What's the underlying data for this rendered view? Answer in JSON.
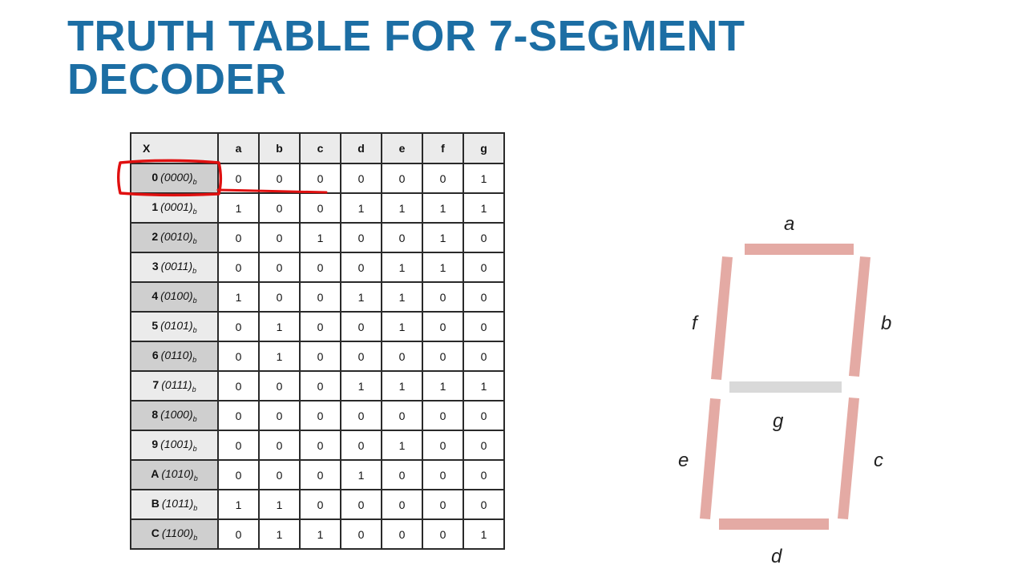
{
  "title_line1": "TRUTH TABLE FOR 7-SEGMENT",
  "title_line2": "DECODER",
  "table": {
    "headers": [
      "X",
      "a",
      "b",
      "c",
      "d",
      "e",
      "f",
      "g"
    ],
    "rows": [
      {
        "digit": "0",
        "binary": "(0000)",
        "base": "b",
        "segments": [
          "0",
          "0",
          "0",
          "0",
          "0",
          "0",
          "1"
        ]
      },
      {
        "digit": "1",
        "binary": "(0001)",
        "base": "b",
        "segments": [
          "1",
          "0",
          "0",
          "1",
          "1",
          "1",
          "1"
        ]
      },
      {
        "digit": "2",
        "binary": "(0010)",
        "base": "b",
        "segments": [
          "0",
          "0",
          "1",
          "0",
          "0",
          "1",
          "0"
        ]
      },
      {
        "digit": "3",
        "binary": "(0011)",
        "base": "b",
        "segments": [
          "0",
          "0",
          "0",
          "0",
          "1",
          "1",
          "0"
        ]
      },
      {
        "digit": "4",
        "binary": "(0100)",
        "base": "b",
        "segments": [
          "1",
          "0",
          "0",
          "1",
          "1",
          "0",
          "0"
        ]
      },
      {
        "digit": "5",
        "binary": "(0101)",
        "base": "b",
        "segments": [
          "0",
          "1",
          "0",
          "0",
          "1",
          "0",
          "0"
        ]
      },
      {
        "digit": "6",
        "binary": "(0110)",
        "base": "b",
        "segments": [
          "0",
          "1",
          "0",
          "0",
          "0",
          "0",
          "0"
        ]
      },
      {
        "digit": "7",
        "binary": "(0111)",
        "base": "b",
        "segments": [
          "0",
          "0",
          "0",
          "1",
          "1",
          "1",
          "1"
        ]
      },
      {
        "digit": "8",
        "binary": "(1000)",
        "base": "b",
        "segments": [
          "0",
          "0",
          "0",
          "0",
          "0",
          "0",
          "0"
        ]
      },
      {
        "digit": "9",
        "binary": "(1001)",
        "base": "b",
        "segments": [
          "0",
          "0",
          "0",
          "0",
          "1",
          "0",
          "0"
        ]
      },
      {
        "digit": "A",
        "binary": "(1010)",
        "base": "b",
        "segments": [
          "0",
          "0",
          "0",
          "1",
          "0",
          "0",
          "0"
        ]
      },
      {
        "digit": "B",
        "binary": "(1011)",
        "base": "b",
        "segments": [
          "1",
          "1",
          "0",
          "0",
          "0",
          "0",
          "0"
        ]
      },
      {
        "digit": "C",
        "binary": "(1100)",
        "base": "b",
        "segments": [
          "0",
          "1",
          "1",
          "0",
          "0",
          "0",
          "1"
        ]
      }
    ]
  },
  "display": {
    "segment_labels": {
      "a": "a",
      "b": "b",
      "c": "c",
      "d": "d",
      "e": "e",
      "f": "f",
      "g": "g"
    },
    "segment_on_color": "#e4aaa4",
    "segment_off_color": "#d9d9d9",
    "segment_states": {
      "a": "on",
      "b": "on",
      "c": "on",
      "d": "on",
      "e": "on",
      "f": "on",
      "g": "off"
    }
  },
  "annotation": {
    "highlight_color": "#e01010",
    "highlighted_row": "0"
  }
}
